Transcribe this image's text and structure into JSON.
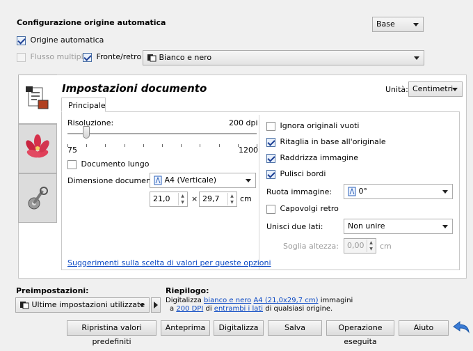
{
  "header": {
    "title": "Configurazione origine automatica",
    "mode_select": "Base"
  },
  "source": {
    "auto_source_label": "Origine automatica",
    "multi_feed_label": "Flusso multiplo",
    "duplex_label": "Fronte/retro",
    "color_mode": "Bianco e nero"
  },
  "document": {
    "title": "Impostazioni documento",
    "units_label": "Unità:",
    "units_value": "Centimetri",
    "tab_main": "Principale",
    "resolution_label": "Risoluzione:",
    "resolution_value": "200 dpi",
    "resolution_slider_fraction": 0.1,
    "resolution_min": "75",
    "resolution_max": "1200",
    "long_doc_label": "Documento lungo",
    "doc_size_label": "Dimensione documento:",
    "doc_size_value": "A4 (Verticale)",
    "width_value": "21,0",
    "height_value": "29,7",
    "times_symbol": "×",
    "unit_cm": "cm",
    "ignore_blank_label": "Ignora originali vuoti",
    "crop_label": "Ritaglia in base all'originale",
    "straighten_label": "Raddrizza immagine",
    "clean_edges_label": "Pulisci bordi",
    "rotate_label": "Ruota immagine:",
    "rotate_value": "0°",
    "flip_back_label": "Capovolgi retro",
    "merge_sides_label": "Unisci due lati:",
    "merge_sides_value": "Non unire",
    "height_threshold_label": "Soglia altezza:",
    "height_threshold_value": "0,00",
    "threshold_unit": "cm",
    "tips_link": "Suggerimenti sulla scelta di valori per queste opzioni"
  },
  "presets": {
    "label": "Preimpostazioni:",
    "value": "Ultime impostazioni utilizzate"
  },
  "summary": {
    "label": "Riepilogo:",
    "line1_a": "Digitalizza",
    "line1_link1": "bianco e nero",
    "line1_link2": "A4 (21,0x29,7 cm)",
    "line1_b": "immagini",
    "line2_a": "a",
    "line2_link1": "200 DPI",
    "line2_b": "di",
    "line2_link2": "entrambi i lati",
    "line2_c": "di qualsiasi origine."
  },
  "buttons": {
    "reset": "Ripristina valori predefiniti",
    "preview": "Anteprima",
    "scan": "Digitalizza",
    "save": "Salva",
    "done": "Operazione eseguita",
    "help": "Aiuto"
  },
  "colors": {
    "link": "#0b49c4",
    "back_arrow": "#3a7bd5"
  }
}
